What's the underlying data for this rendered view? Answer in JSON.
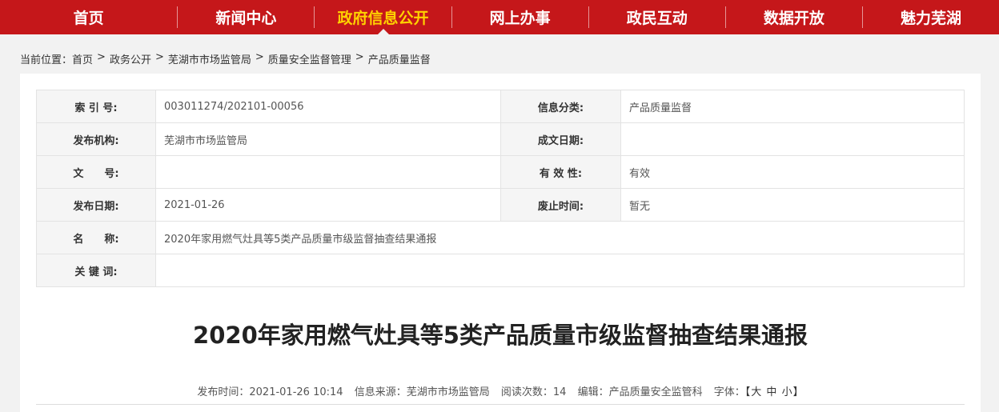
{
  "nav": {
    "items": [
      {
        "label": "首页"
      },
      {
        "label": "新闻中心"
      },
      {
        "label": "政府信息公开"
      },
      {
        "label": "网上办事"
      },
      {
        "label": "政民互动"
      },
      {
        "label": "数据开放"
      },
      {
        "label": "魅力芜湖"
      }
    ],
    "active_color": "#ffd200",
    "bar_color": "#c5171a"
  },
  "breadcrumb": {
    "prefix": "当前位置：",
    "items": [
      "首页",
      "政务公开",
      "芜湖市市场监管局",
      "质量安全监督管理",
      "产品质量监督"
    ],
    "separator": ">"
  },
  "meta": {
    "index_label": "索 引 号:",
    "index_value": "003011274/202101-00056",
    "category_label": "信息分类:",
    "category_value": "产品质量监督",
    "publisher_label": "发布机构:",
    "publisher_value": "芜湖市市场监管局",
    "created_label": "成文日期:",
    "created_value": "",
    "docno_label": "文　　号:",
    "docno_value": "",
    "validity_label": "有 效 性:",
    "validity_value": "有效",
    "pubdate_label": "发布日期:",
    "pubdate_value": "2021-01-26",
    "abolish_label": "废止时间:",
    "abolish_value": "暂无",
    "name_label": "名　　称:",
    "name_value": "2020年家用燃气灶具等5类产品质量市级监督抽查结果通报",
    "keywords_label": "关 键 词:",
    "keywords_value": ""
  },
  "article": {
    "title": "2020年家用燃气灶具等5类产品质量市级监督抽查结果通报",
    "pubtime_label": "发布时间：",
    "pubtime_value": "2021-01-26 10:14",
    "source_label": "信息来源：",
    "source_value": "芜湖市市场监管局",
    "reads_label": "阅读次数：",
    "reads_value": "14",
    "editor_label": "编辑：",
    "editor_value": "产品质量安全监管科",
    "font_label": "字体：",
    "font_open": "【",
    "font_large": "大",
    "font_medium": "中",
    "font_small": "小",
    "font_close": "】"
  }
}
